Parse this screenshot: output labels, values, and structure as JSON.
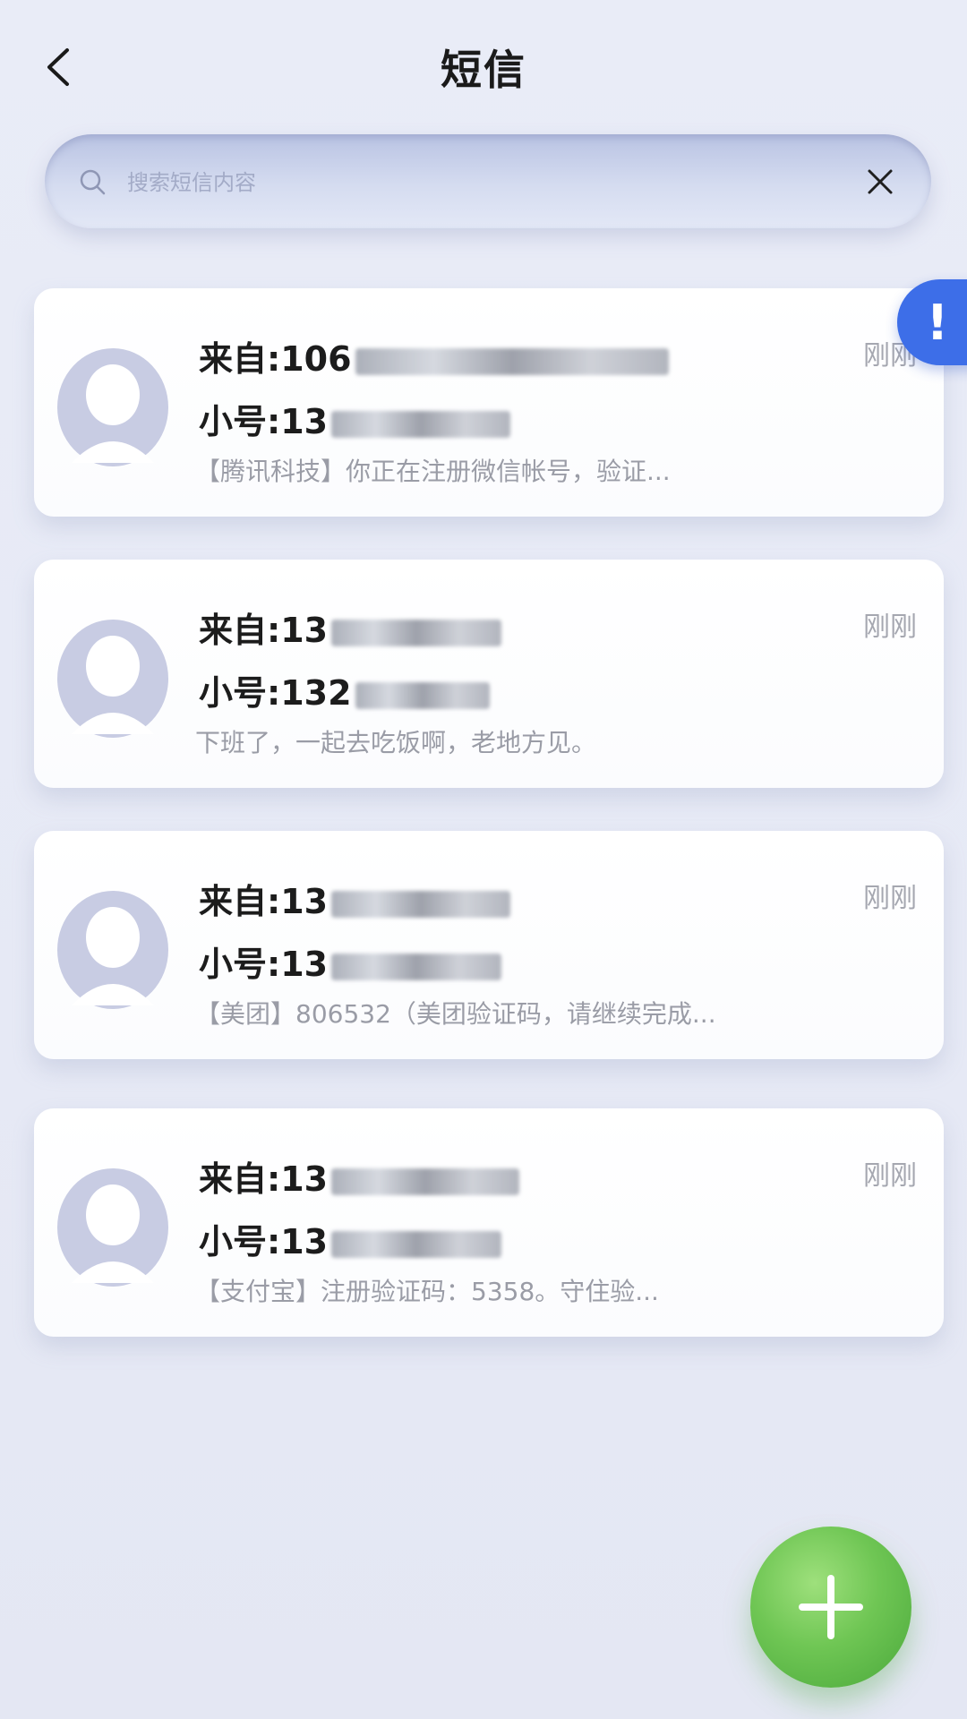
{
  "header": {
    "title": "短信"
  },
  "search": {
    "placeholder": "搜索短信内容",
    "value": ""
  },
  "alert_tab": {
    "label": "!"
  },
  "messages": [
    {
      "from_label": "来自:106",
      "to_label": "小号:13",
      "preview": "【腾讯科技】你正在注册微信帐号，验证...",
      "time": "刚刚"
    },
    {
      "from_label": "来自:13",
      "to_label": "小号:132",
      "preview": "下班了，一起去吃饭啊，老地方见。",
      "time": "刚刚"
    },
    {
      "from_label": "来自:13",
      "to_label": "小号:13",
      "preview": "【美团】806532（美团验证码，请继续完成...",
      "time": "刚刚"
    },
    {
      "from_label": "来自:13",
      "to_label": "小号:13",
      "preview": "【支付宝】注册验证码：5358。守住验...",
      "time": "刚刚"
    }
  ],
  "icons": {
    "back": "chevron-left-icon",
    "search": "search-icon",
    "clear": "close-icon",
    "avatar": "user-avatar-icon",
    "add": "plus-icon"
  },
  "colors": {
    "accent_blue": "#3d6ee8",
    "fab_green": "#5cbf46",
    "background": "#e7eaf5"
  }
}
